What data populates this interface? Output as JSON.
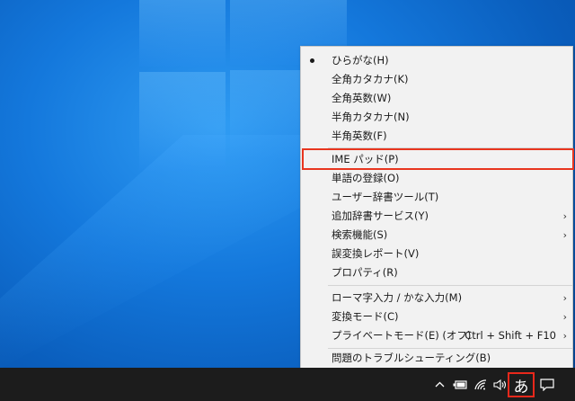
{
  "menu": {
    "items": [
      {
        "label": "ひらがな(H)",
        "selected": true
      },
      {
        "label": "全角カタカナ(K)"
      },
      {
        "label": "全角英数(W)"
      },
      {
        "label": "半角カタカナ(N)"
      },
      {
        "label": "半角英数(F)"
      },
      {
        "label": "IME パッド(P)",
        "highlighted": true
      },
      {
        "label": "単語の登録(O)"
      },
      {
        "label": "ユーザー辞書ツール(T)"
      },
      {
        "label": "追加辞書サービス(Y)",
        "submenu": true
      },
      {
        "label": "検索機能(S)",
        "submenu": true
      },
      {
        "label": "誤変換レポート(V)"
      },
      {
        "label": "プロパティ(R)"
      },
      {
        "label": "ローマ字入力 / かな入力(M)",
        "submenu": true
      },
      {
        "label": "変換モード(C)",
        "submenu": true
      },
      {
        "label": "プライベートモード(E) (オフ)",
        "accelerator": "Ctrl + Shift + F10",
        "submenu": true
      },
      {
        "label": "問題のトラブルシューティング(B)"
      }
    ],
    "submenu_arrow": "›",
    "highlight_color": "#e8361f"
  },
  "taskbar": {
    "ime_mode_text": "あ",
    "icons": [
      "chevron-up-icon",
      "battery-icon",
      "wifi-icon",
      "speaker-icon",
      "notification-icon"
    ]
  },
  "colors": {
    "desktop": "#1478dc",
    "taskbar": "#1c1c1c",
    "annotation_red": "#e8281b"
  }
}
